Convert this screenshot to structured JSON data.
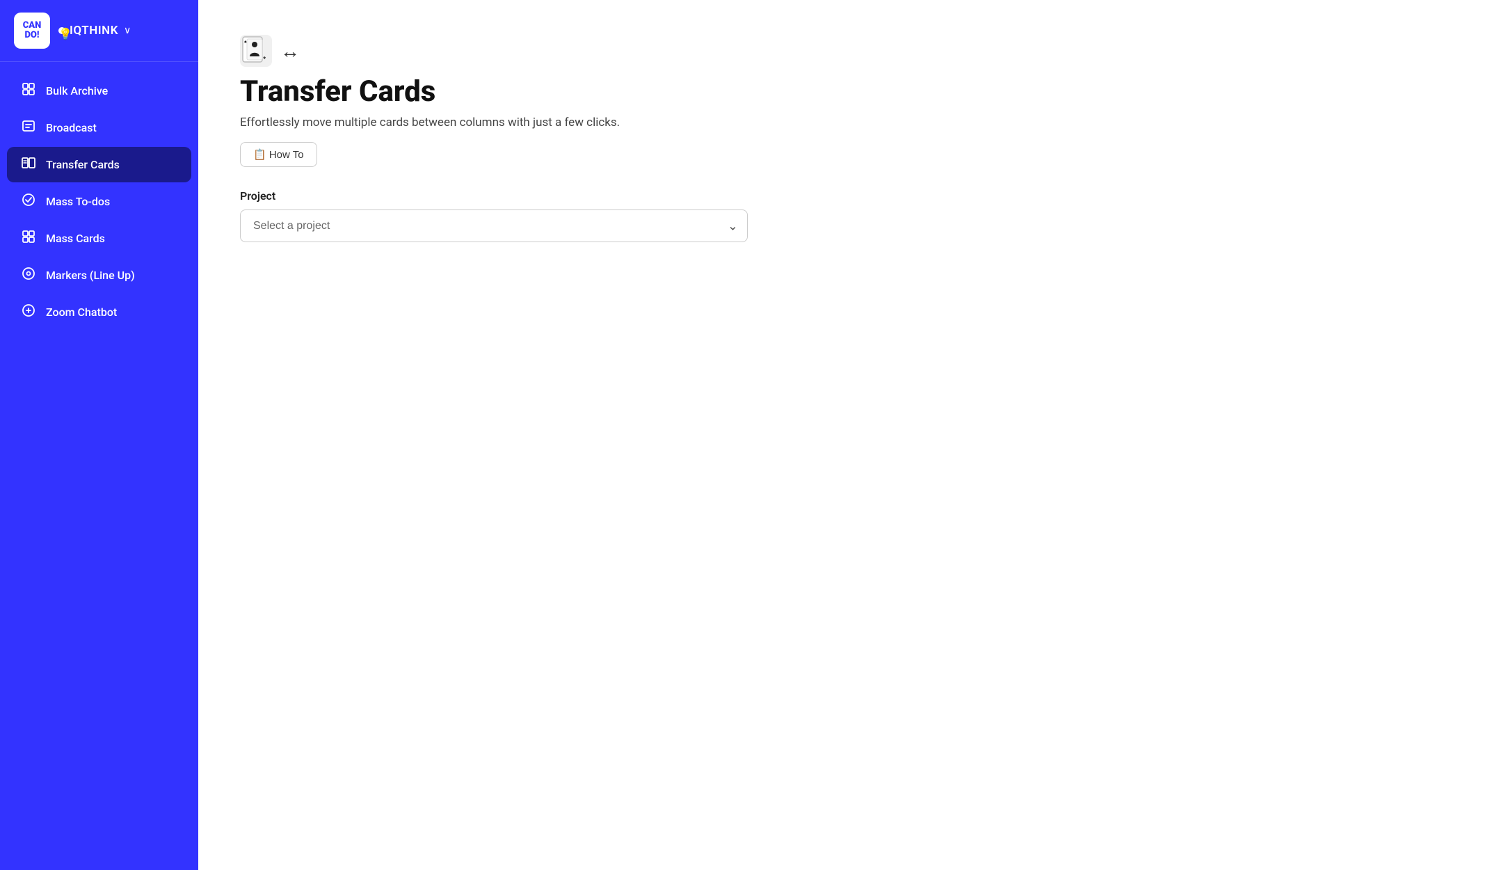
{
  "sidebar": {
    "logo_line1": "CAN",
    "logo_line2": "DO!",
    "org": {
      "name": "IQTHINK",
      "chevron": "∨"
    },
    "nav_items": [
      {
        "id": "bulk-archive",
        "label": "Bulk Archive",
        "icon": "⊞",
        "active": false
      },
      {
        "id": "broadcast",
        "label": "Broadcast",
        "icon": "⊡",
        "active": false
      },
      {
        "id": "transfer-cards",
        "label": "Transfer Cards",
        "icon": "⊟",
        "active": true
      },
      {
        "id": "mass-to-dos",
        "label": "Mass To-dos",
        "icon": "⊠",
        "active": false
      },
      {
        "id": "mass-cards",
        "label": "Mass Cards",
        "icon": "⊞",
        "active": false
      },
      {
        "id": "markers-lineup",
        "label": "Markers (Line Up)",
        "icon": "⊕",
        "active": false
      },
      {
        "id": "zoom-chatbot",
        "label": "Zoom Chatbot",
        "icon": "⊜",
        "active": false
      }
    ]
  },
  "main": {
    "page_icon": "🃏",
    "transfer_arrow": "↔",
    "title": "Transfer Cards",
    "subtitle": "Effortlessly move multiple cards between columns with just a few clicks.",
    "how_to_label": "📋 How To",
    "project_section": {
      "label": "Project",
      "select_placeholder": "Select a project",
      "options": []
    }
  }
}
